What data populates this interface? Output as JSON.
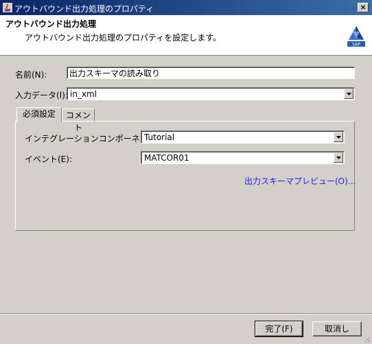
{
  "window": {
    "title": "アウトバウンド出力処理のプロパティ",
    "close_glyph": "×"
  },
  "header": {
    "title": "アウトバウンド出力処理",
    "description": "アウトバウンド出力処理のプロパティを設定します。",
    "logo_text": "SAP"
  },
  "form": {
    "name_label": "名前(N):",
    "name_value": "出力スキーマの読み取り",
    "input_data_label": "入力データ(I):",
    "input_data_value": "in_xml"
  },
  "tabs": [
    {
      "label": "必須設定"
    },
    {
      "label": "コメント"
    }
  ],
  "required_tab": {
    "component_label": "インテグレーションコンポーネント(C):",
    "component_value": "Tutorial",
    "event_label": "イベント(E):",
    "event_value": "MATCOR01",
    "preview_link": "出力スキーマプレビュー(O)..."
  },
  "buttons": {
    "ok_label": "完了(F)",
    "cancel_label": "取消し"
  }
}
